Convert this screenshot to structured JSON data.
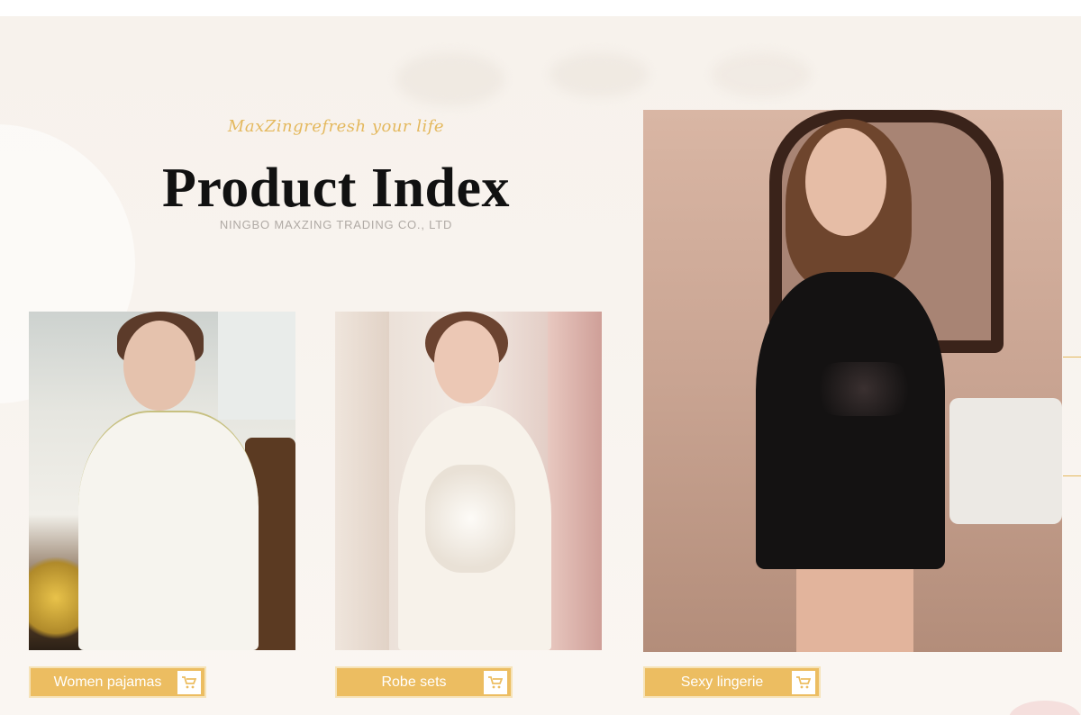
{
  "header": {
    "tagline": "MaxZingrefresh your life",
    "title": "Product Index",
    "subtitle": "NINGBO MAXZING TRADING CO., LTD"
  },
  "products": [
    {
      "label": "Women pajamas",
      "icon": "shopping-cart-icon"
    },
    {
      "label": "Robe sets",
      "icon": "shopping-cart-icon"
    },
    {
      "label": "Sexy lingerie",
      "icon": "shopping-cart-icon"
    }
  ],
  "colors": {
    "accent": "#ecbd61",
    "tagline": "#e4b85d",
    "title": "#111111",
    "background": "#f8f3ee"
  }
}
